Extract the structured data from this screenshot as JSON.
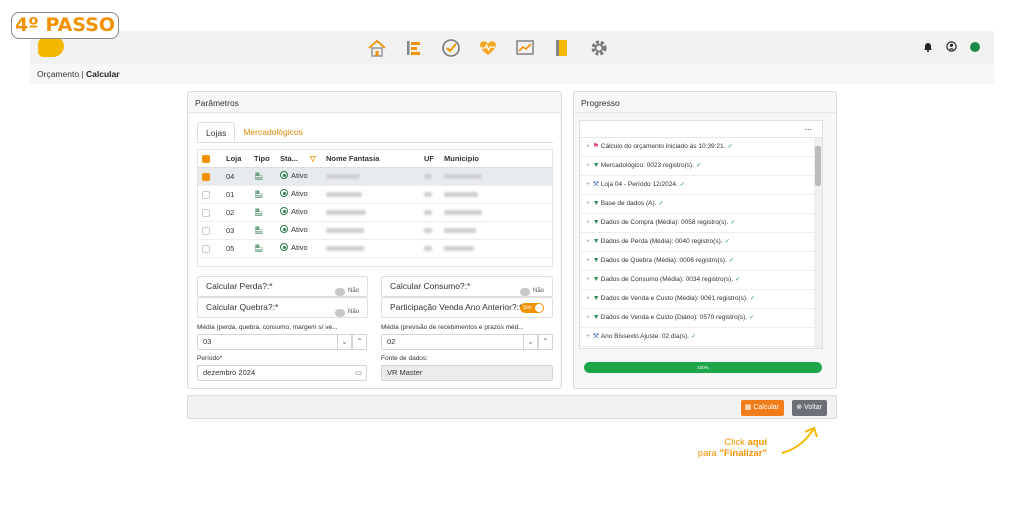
{
  "step_badge": "4º PASSO",
  "logo": "",
  "breadcrumb": {
    "parent": "Orçamento |",
    "current": "Calcular"
  },
  "params": {
    "title": "Parâmetros",
    "tabs": [
      "Lojas",
      "Mercadológicos"
    ],
    "columns": [
      "Loja",
      "Tipo",
      "Sta...",
      "Nome Fantasia",
      "UF",
      "Municipio"
    ],
    "rows": [
      {
        "loja": "04",
        "status": "Ativo",
        "selected": true
      },
      {
        "loja": "01",
        "status": "Ativo",
        "selected": false
      },
      {
        "loja": "02",
        "status": "Ativo",
        "selected": false
      },
      {
        "loja": "03",
        "status": "Ativo",
        "selected": false
      },
      {
        "loja": "05",
        "status": "Ativo",
        "selected": false
      }
    ],
    "calc_perda": {
      "label": "Calcular Perda?:*",
      "value": "Não"
    },
    "calc_consumo": {
      "label": "Calcular Consumo?:*",
      "value": "Não"
    },
    "calc_quebra": {
      "label": "Calcular Quebra?:*",
      "value": "Não"
    },
    "participacao": {
      "label": "Participação Venda Ano Anterior?:*",
      "value": "Sim"
    },
    "media1": {
      "label": "Média (perda, quebra, consumo, margem s/ ve...",
      "value": "03"
    },
    "media2": {
      "label": "Média (previsão de recebimentos e prazos méd...",
      "value": "02"
    },
    "periodo": {
      "label": "Período*",
      "value": "dezembro 2024"
    },
    "fonte": {
      "label": "Fonte de dados:",
      "value": "VR Master"
    }
  },
  "progress": {
    "title": "Progresso",
    "menu": "...",
    "items": [
      {
        "icon": "flag-icon",
        "text": "Cálculo do orçamento iniciado às 10:39:21.",
        "color": "#e0337a"
      },
      {
        "icon": "filter-icon",
        "text": "Mercadológico: 0023 registro(s).",
        "color": "#2e8b57"
      },
      {
        "icon": "hammer-icon",
        "text": "Loja 04 - Período 12/2024.",
        "color": "#3a6ea5"
      },
      {
        "icon": "filter-icon",
        "text": "Base de dados (A).",
        "color": "#2e8b57"
      },
      {
        "icon": "filter-icon",
        "text": "Dados de Compra (Média): 0058 registro(s).",
        "color": "#2e8b57"
      },
      {
        "icon": "filter-icon",
        "text": "Dados de Perda (Média): 0040 registro(s).",
        "color": "#2e8b57"
      },
      {
        "icon": "filter-icon",
        "text": "Dados de Quebra (Média): 0006 registro(s).",
        "color": "#2e8b57"
      },
      {
        "icon": "filter-icon",
        "text": "Dados de Consumo (Média): 0034 registro(s).",
        "color": "#2e8b57"
      },
      {
        "icon": "filter-icon",
        "text": "Dados de Venda e Custo (Média): 0061 registro(s).",
        "color": "#2e8b57"
      },
      {
        "icon": "filter-icon",
        "text": "Dados de Venda e Custo (Diário): 0570 registro(s).",
        "color": "#2e8b57"
      },
      {
        "icon": "hammer-icon",
        "text": "Ano Bissexto Ajuste: 02 dia(s).",
        "color": "#3a6ea5"
      }
    ],
    "percent": "100%"
  },
  "buttons": {
    "calcular": "Calcular",
    "voltar": "Voltar"
  },
  "hint": {
    "line1": "Click ",
    "line1b": "aqui",
    "line2": "para ",
    "line2b": "\"Finalizar\""
  },
  "colors": {
    "accent": "#f39200",
    "success": "#1ea64a"
  }
}
